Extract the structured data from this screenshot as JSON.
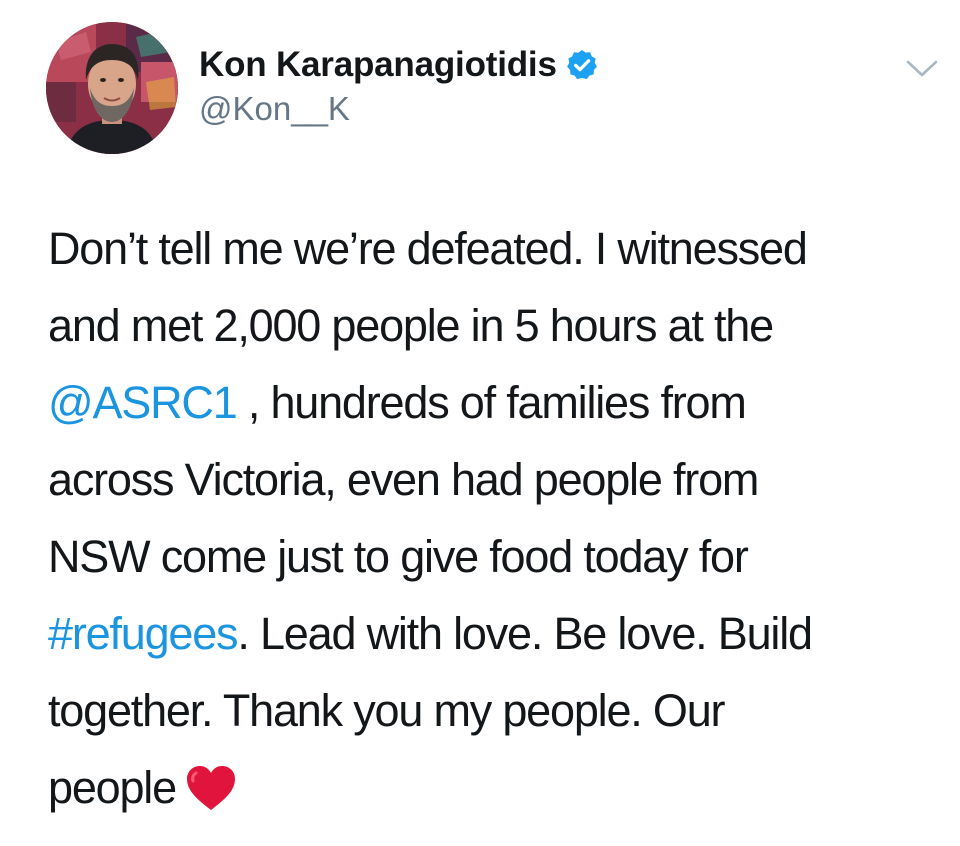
{
  "author": {
    "display_name": "Kon Karapanagiotidis",
    "handle": "@Kon__K",
    "verified_icon": "verified-badge-icon",
    "avatar_icon": "profile-photo"
  },
  "menu": {
    "icon": "chevron-down-icon"
  },
  "tweet": {
    "line1": "Don’t tell me we’re defeated. I witnessed",
    "line2": "and met 2,000 people in 5 hours at the",
    "line3_mention": "@ASRC1",
    "line3_rest": " , hundreds of families from",
    "line4": "across Victoria, even had people from",
    "line5": "NSW come just to give food today for",
    "line6_hashtag": "#refugees",
    "line6_rest": ". Lead with love. Be love. Build",
    "line7": "together. Thank you my people. Our",
    "line8": "people",
    "emoji": "red-heart-icon"
  },
  "colors": {
    "text": "#14171a",
    "secondary_text": "#657786",
    "link": "#1b95e0",
    "verified_badge": "#1da1f2",
    "heart": "#e0143c"
  }
}
